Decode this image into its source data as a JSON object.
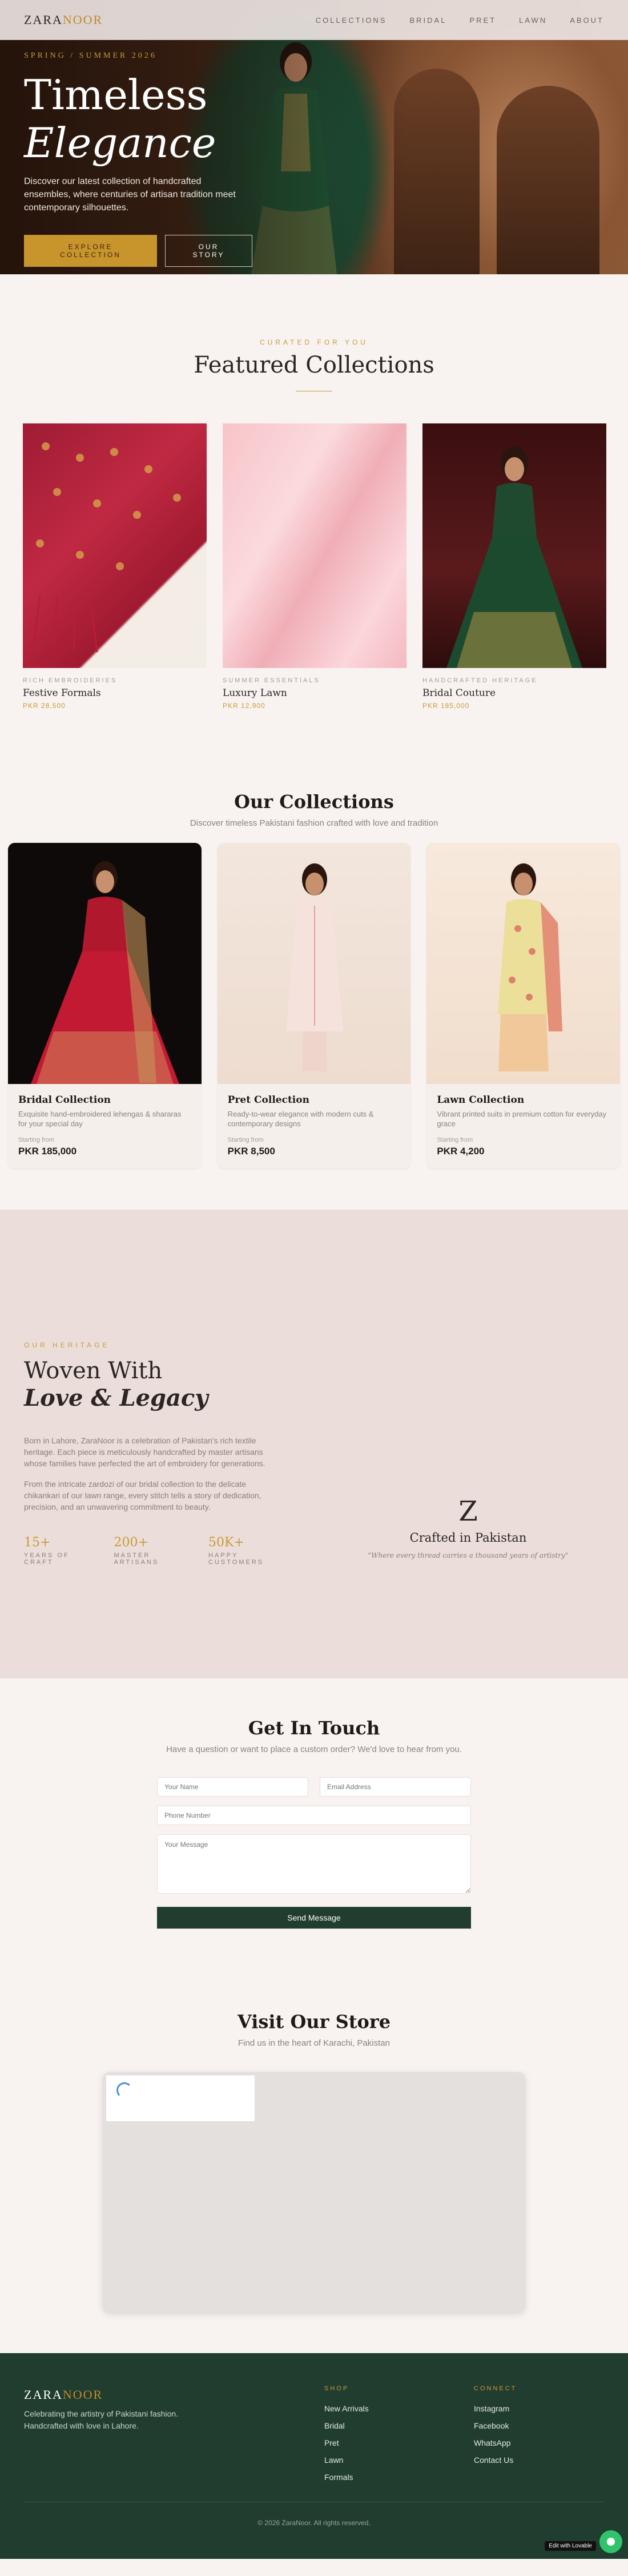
{
  "brand": {
    "name_part1": "ZARA",
    "name_part2": "NOOR"
  },
  "nav": {
    "items": [
      "COLLECTIONS",
      "BRIDAL",
      "PRET",
      "LAWN",
      "ABOUT"
    ]
  },
  "hero": {
    "eyebrow": "SPRING / SUMMER 2026",
    "title_line1": "Timeless",
    "title_line2": "Elegance",
    "description": "Discover our latest collection of handcrafted ensembles, where centuries of artisan tradition meet contemporary silhouettes.",
    "primary_button": "EXPLORE COLLECTION",
    "secondary_button": "OUR STORY"
  },
  "featured": {
    "eyebrow": "CURATED FOR YOU",
    "title": "Featured Collections",
    "items": [
      {
        "category": "RICH EMBROIDERIES",
        "name": "Festive Formals",
        "price": "PKR 28,500"
      },
      {
        "category": "SUMMER ESSENTIALS",
        "name": "Luxury Lawn",
        "price": "PKR 12,900"
      },
      {
        "category": "HANDCRAFTED HERITAGE",
        "name": "Bridal Couture",
        "price": "PKR 185,000"
      }
    ]
  },
  "collections": {
    "title": "Our Collections",
    "subtitle": "Discover timeless Pakistani fashion crafted with love and tradition",
    "items": [
      {
        "name": "Bridal Collection",
        "description": "Exquisite hand-embroidered lehengas & shararas for your special day",
        "starting_label": "Starting from",
        "price": "PKR 185,000"
      },
      {
        "name": "Pret Collection",
        "description": "Ready-to-wear elegance with modern cuts & contemporary designs",
        "starting_label": "Starting from",
        "price": "PKR 8,500"
      },
      {
        "name": "Lawn Collection",
        "description": "Vibrant printed suits in premium cotton for everyday grace",
        "starting_label": "Starting from",
        "price": "PKR 4,200"
      }
    ]
  },
  "heritage": {
    "eyebrow": "OUR HERITAGE",
    "title_line1": "Woven With",
    "title_line2": "Love & Legacy",
    "paragraph1": "Born in Lahore, ZaraNoor is a celebration of Pakistan's rich textile heritage. Each piece is meticulously handcrafted by master artisans whose families have perfected the art of embroidery for generations.",
    "paragraph2": "From the intricate zardozi of our bridal collection to the delicate chikankari of our lawn range, every stitch tells a story of dedication, precision, and an unwavering commitment to beauty.",
    "stats": [
      {
        "value": "15+",
        "label": "YEARS OF CRAFT"
      },
      {
        "value": "200+",
        "label": "MASTER ARTISANS"
      },
      {
        "value": "50K+",
        "label": "HAPPY CUSTOMERS"
      }
    ],
    "monogram": "Z",
    "crafted": "Crafted in Pakistan",
    "quote": "\"Where every thread carries a thousand years of artistry\""
  },
  "contact": {
    "title": "Get In Touch",
    "subtitle": "Have a question or want to place a custom order? We'd love to hear from you.",
    "name_placeholder": "Your Name",
    "email_placeholder": "Email Address",
    "phone_placeholder": "Phone Number",
    "message_placeholder": "Your Message",
    "send_label": "Send Message"
  },
  "store": {
    "title": "Visit Our Store",
    "subtitle": "Find us in the heart of Karachi, Pakistan"
  },
  "footer": {
    "tagline": "Celebrating the artistry of Pakistani fashion. Handcrafted with love in Lahore.",
    "shop_heading": "SHOP",
    "shop_links": [
      "New Arrivals",
      "Bridal",
      "Pret",
      "Lawn",
      "Formals"
    ],
    "connect_heading": "CONNECT",
    "connect_links": [
      "Instagram",
      "Facebook",
      "WhatsApp",
      "Contact Us"
    ],
    "copyright": "© 2026 ZaraNoor. All rights reserved.",
    "badge": "Edit with Lovable"
  },
  "colors": {
    "gold": "#c99a3a",
    "forest_green": "#213d2f",
    "cream": "#f8f3f1",
    "blush": "#ebdeda"
  }
}
